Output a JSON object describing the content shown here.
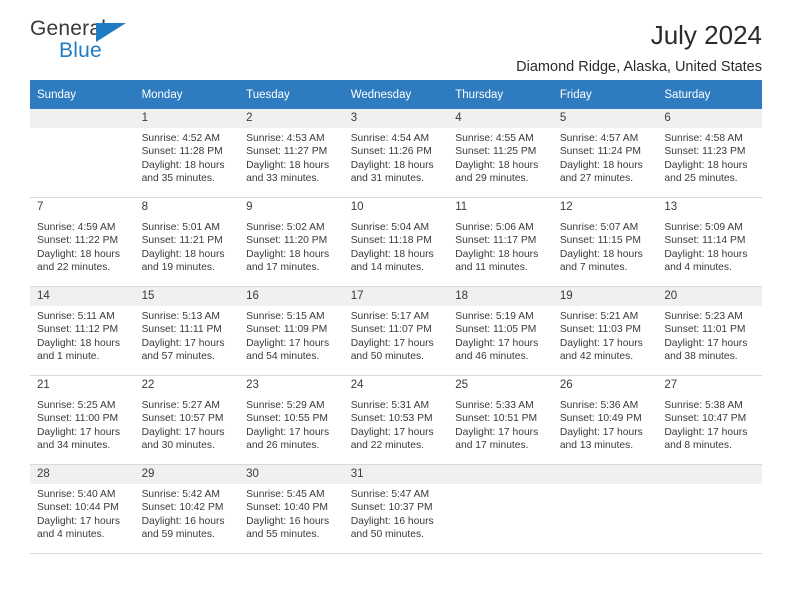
{
  "logo": {
    "primary_text": "General",
    "secondary_text": "Blue",
    "triangle_icon": "triangle-icon",
    "accent_color": "#1f7cc4"
  },
  "header": {
    "title": "July 2024",
    "subtitle": "Diamond Ridge, Alaska, United States"
  },
  "colors": {
    "header_row": "#2e7bbf",
    "header_text": "#ffffff",
    "cell_shade": "#f0f0f0",
    "text": "#3a3a3a"
  },
  "weekday_headers": [
    "Sunday",
    "Monday",
    "Tuesday",
    "Wednesday",
    "Thursday",
    "Friday",
    "Saturday"
  ],
  "weeks": [
    [
      {
        "day": "",
        "sunrise": "",
        "sunset": "",
        "daylight1": "",
        "daylight2": ""
      },
      {
        "day": "1",
        "sunrise": "Sunrise: 4:52 AM",
        "sunset": "Sunset: 11:28 PM",
        "daylight1": "Daylight: 18 hours",
        "daylight2": "and 35 minutes."
      },
      {
        "day": "2",
        "sunrise": "Sunrise: 4:53 AM",
        "sunset": "Sunset: 11:27 PM",
        "daylight1": "Daylight: 18 hours",
        "daylight2": "and 33 minutes."
      },
      {
        "day": "3",
        "sunrise": "Sunrise: 4:54 AM",
        "sunset": "Sunset: 11:26 PM",
        "daylight1": "Daylight: 18 hours",
        "daylight2": "and 31 minutes."
      },
      {
        "day": "4",
        "sunrise": "Sunrise: 4:55 AM",
        "sunset": "Sunset: 11:25 PM",
        "daylight1": "Daylight: 18 hours",
        "daylight2": "and 29 minutes."
      },
      {
        "day": "5",
        "sunrise": "Sunrise: 4:57 AM",
        "sunset": "Sunset: 11:24 PM",
        "daylight1": "Daylight: 18 hours",
        "daylight2": "and 27 minutes."
      },
      {
        "day": "6",
        "sunrise": "Sunrise: 4:58 AM",
        "sunset": "Sunset: 11:23 PM",
        "daylight1": "Daylight: 18 hours",
        "daylight2": "and 25 minutes."
      }
    ],
    [
      {
        "day": "7",
        "sunrise": "Sunrise: 4:59 AM",
        "sunset": "Sunset: 11:22 PM",
        "daylight1": "Daylight: 18 hours",
        "daylight2": "and 22 minutes."
      },
      {
        "day": "8",
        "sunrise": "Sunrise: 5:01 AM",
        "sunset": "Sunset: 11:21 PM",
        "daylight1": "Daylight: 18 hours",
        "daylight2": "and 19 minutes."
      },
      {
        "day": "9",
        "sunrise": "Sunrise: 5:02 AM",
        "sunset": "Sunset: 11:20 PM",
        "daylight1": "Daylight: 18 hours",
        "daylight2": "and 17 minutes."
      },
      {
        "day": "10",
        "sunrise": "Sunrise: 5:04 AM",
        "sunset": "Sunset: 11:18 PM",
        "daylight1": "Daylight: 18 hours",
        "daylight2": "and 14 minutes."
      },
      {
        "day": "11",
        "sunrise": "Sunrise: 5:06 AM",
        "sunset": "Sunset: 11:17 PM",
        "daylight1": "Daylight: 18 hours",
        "daylight2": "and 11 minutes."
      },
      {
        "day": "12",
        "sunrise": "Sunrise: 5:07 AM",
        "sunset": "Sunset: 11:15 PM",
        "daylight1": "Daylight: 18 hours",
        "daylight2": "and 7 minutes."
      },
      {
        "day": "13",
        "sunrise": "Sunrise: 5:09 AM",
        "sunset": "Sunset: 11:14 PM",
        "daylight1": "Daylight: 18 hours",
        "daylight2": "and 4 minutes."
      }
    ],
    [
      {
        "day": "14",
        "sunrise": "Sunrise: 5:11 AM",
        "sunset": "Sunset: 11:12 PM",
        "daylight1": "Daylight: 18 hours",
        "daylight2": "and 1 minute."
      },
      {
        "day": "15",
        "sunrise": "Sunrise: 5:13 AM",
        "sunset": "Sunset: 11:11 PM",
        "daylight1": "Daylight: 17 hours",
        "daylight2": "and 57 minutes."
      },
      {
        "day": "16",
        "sunrise": "Sunrise: 5:15 AM",
        "sunset": "Sunset: 11:09 PM",
        "daylight1": "Daylight: 17 hours",
        "daylight2": "and 54 minutes."
      },
      {
        "day": "17",
        "sunrise": "Sunrise: 5:17 AM",
        "sunset": "Sunset: 11:07 PM",
        "daylight1": "Daylight: 17 hours",
        "daylight2": "and 50 minutes."
      },
      {
        "day": "18",
        "sunrise": "Sunrise: 5:19 AM",
        "sunset": "Sunset: 11:05 PM",
        "daylight1": "Daylight: 17 hours",
        "daylight2": "and 46 minutes."
      },
      {
        "day": "19",
        "sunrise": "Sunrise: 5:21 AM",
        "sunset": "Sunset: 11:03 PM",
        "daylight1": "Daylight: 17 hours",
        "daylight2": "and 42 minutes."
      },
      {
        "day": "20",
        "sunrise": "Sunrise: 5:23 AM",
        "sunset": "Sunset: 11:01 PM",
        "daylight1": "Daylight: 17 hours",
        "daylight2": "and 38 minutes."
      }
    ],
    [
      {
        "day": "21",
        "sunrise": "Sunrise: 5:25 AM",
        "sunset": "Sunset: 11:00 PM",
        "daylight1": "Daylight: 17 hours",
        "daylight2": "and 34 minutes."
      },
      {
        "day": "22",
        "sunrise": "Sunrise: 5:27 AM",
        "sunset": "Sunset: 10:57 PM",
        "daylight1": "Daylight: 17 hours",
        "daylight2": "and 30 minutes."
      },
      {
        "day": "23",
        "sunrise": "Sunrise: 5:29 AM",
        "sunset": "Sunset: 10:55 PM",
        "daylight1": "Daylight: 17 hours",
        "daylight2": "and 26 minutes."
      },
      {
        "day": "24",
        "sunrise": "Sunrise: 5:31 AM",
        "sunset": "Sunset: 10:53 PM",
        "daylight1": "Daylight: 17 hours",
        "daylight2": "and 22 minutes."
      },
      {
        "day": "25",
        "sunrise": "Sunrise: 5:33 AM",
        "sunset": "Sunset: 10:51 PM",
        "daylight1": "Daylight: 17 hours",
        "daylight2": "and 17 minutes."
      },
      {
        "day": "26",
        "sunrise": "Sunrise: 5:36 AM",
        "sunset": "Sunset: 10:49 PM",
        "daylight1": "Daylight: 17 hours",
        "daylight2": "and 13 minutes."
      },
      {
        "day": "27",
        "sunrise": "Sunrise: 5:38 AM",
        "sunset": "Sunset: 10:47 PM",
        "daylight1": "Daylight: 17 hours",
        "daylight2": "and 8 minutes."
      }
    ],
    [
      {
        "day": "28",
        "sunrise": "Sunrise: 5:40 AM",
        "sunset": "Sunset: 10:44 PM",
        "daylight1": "Daylight: 17 hours",
        "daylight2": "and 4 minutes."
      },
      {
        "day": "29",
        "sunrise": "Sunrise: 5:42 AM",
        "sunset": "Sunset: 10:42 PM",
        "daylight1": "Daylight: 16 hours",
        "daylight2": "and 59 minutes."
      },
      {
        "day": "30",
        "sunrise": "Sunrise: 5:45 AM",
        "sunset": "Sunset: 10:40 PM",
        "daylight1": "Daylight: 16 hours",
        "daylight2": "and 55 minutes."
      },
      {
        "day": "31",
        "sunrise": "Sunrise: 5:47 AM",
        "sunset": "Sunset: 10:37 PM",
        "daylight1": "Daylight: 16 hours",
        "daylight2": "and 50 minutes."
      },
      {
        "day": "",
        "sunrise": "",
        "sunset": "",
        "daylight1": "",
        "daylight2": ""
      },
      {
        "day": "",
        "sunrise": "",
        "sunset": "",
        "daylight1": "",
        "daylight2": ""
      },
      {
        "day": "",
        "sunrise": "",
        "sunset": "",
        "daylight1": "",
        "daylight2": ""
      }
    ]
  ]
}
